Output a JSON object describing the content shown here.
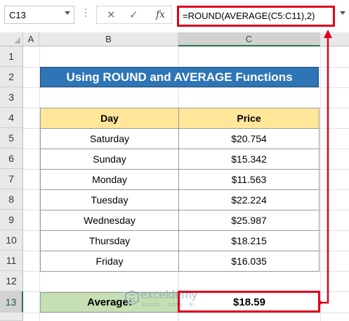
{
  "formula_bar": {
    "name_box": "C13",
    "cancel_icon": "✕",
    "enter_icon": "✓",
    "fx_icon": "fx",
    "formula": "=ROUND(AVERAGE(C5:C11),2)"
  },
  "columns": [
    "A",
    "B",
    "C"
  ],
  "rows": [
    "1",
    "2",
    "3",
    "4",
    "5",
    "6",
    "7",
    "8",
    "9",
    "10",
    "11",
    "12",
    "13"
  ],
  "title": "Using ROUND and AVERAGE Functions",
  "table": {
    "headers": [
      "Day",
      "Price"
    ],
    "rows": [
      [
        "Saturday",
        "$20.754"
      ],
      [
        "Sunday",
        "$15.342"
      ],
      [
        "Monday",
        "$11.563"
      ],
      [
        "Tuesday",
        "$22.224"
      ],
      [
        "Wednesday",
        "$25.987"
      ],
      [
        "Thursday",
        "$18.215"
      ],
      [
        "Friday",
        "$16.035"
      ]
    ]
  },
  "average": {
    "label": "Average:",
    "value": "$18.59"
  },
  "watermark": {
    "name": "exceldemy",
    "tagline": "EXCEL · DATA · BI"
  },
  "colors": {
    "title_fill": "#2e75b6",
    "header_fill": "#ffe699",
    "average_fill": "#c6e0b4",
    "highlight": "#e0001b",
    "selection": "#217346"
  }
}
